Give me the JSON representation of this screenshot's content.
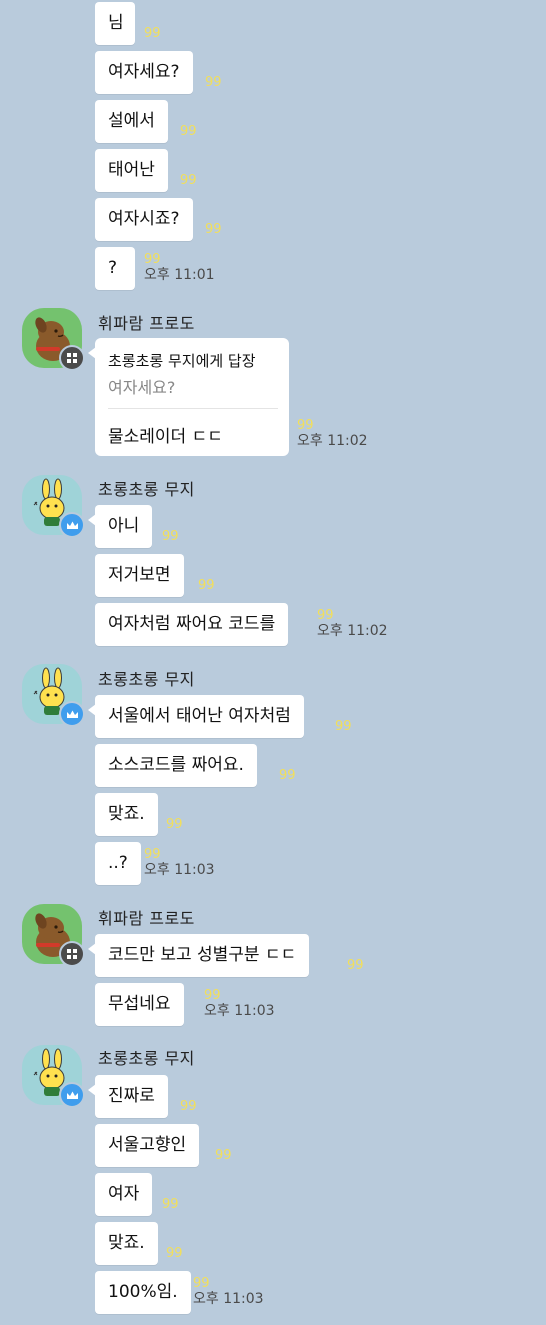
{
  "chat": {
    "groups": [
      {
        "messages": [
          {
            "text": "님",
            "unread": "99",
            "time": ""
          },
          {
            "text": "여자세요?",
            "unread": "99",
            "time": ""
          },
          {
            "text": "설에서",
            "unread": "99",
            "time": ""
          },
          {
            "text": "태어난",
            "unread": "99",
            "time": ""
          },
          {
            "text": "여자시죠?",
            "unread": "99",
            "time": ""
          },
          {
            "text": "?",
            "unread": "99",
            "time": "오후 11:01"
          }
        ]
      },
      {
        "sender": "휘파람 프로도",
        "avatar": "frodo-avatar",
        "badge": "manager-badge-icon",
        "reply": {
          "header": "초롱초롱 무지에게 답장",
          "quoted": "여자세요?",
          "text": "물소레이더 ㄷㄷ",
          "unread": "99",
          "time": "오후 11:02"
        }
      },
      {
        "sender": "초롱초롱 무지",
        "avatar": "muzi-avatar",
        "badge": "crown-icon",
        "messages": [
          {
            "text": "아니",
            "unread": "99",
            "time": ""
          },
          {
            "text": "저거보면",
            "unread": "99",
            "time": ""
          },
          {
            "text": "여자처럼 짜어요 코드를",
            "unread": "99",
            "time": "오후 11:02"
          }
        ]
      },
      {
        "sender": "초롱초롱 무지",
        "avatar": "muzi-avatar",
        "badge": "crown-icon",
        "messages": [
          {
            "text": "서울에서 태어난 여자처럼",
            "unread": "99",
            "time": ""
          },
          {
            "text": "소스코드를 짜어요.",
            "unread": "99",
            "time": ""
          },
          {
            "text": "맞죠.",
            "unread": "99",
            "time": ""
          },
          {
            "text": "..?",
            "unread": "99",
            "time": "오후 11:03"
          }
        ]
      },
      {
        "sender": "휘파람 프로도",
        "avatar": "frodo-avatar",
        "badge": "manager-badge-icon",
        "messages": [
          {
            "text": "코드만 보고 성별구분 ㄷㄷ",
            "unread": "99",
            "time": ""
          },
          {
            "text": "무섭네요",
            "unread": "99",
            "time": "오후 11:03"
          }
        ]
      },
      {
        "sender": "초롱초롱 무지",
        "avatar": "muzi-avatar",
        "badge": "crown-icon",
        "messages": [
          {
            "text": "진짜로",
            "unread": "99",
            "time": ""
          },
          {
            "text": "서울고향인",
            "unread": "99",
            "time": ""
          },
          {
            "text": "여자",
            "unread": "99",
            "time": ""
          },
          {
            "text": "맞죠.",
            "unread": "99",
            "time": ""
          },
          {
            "text": "100%임.",
            "unread": "99",
            "time": "오후 11:03"
          }
        ]
      }
    ]
  },
  "colors": {
    "background": "#b9cbdc",
    "bubble": "#ffffff",
    "unread": "#f2df5a",
    "host_badge": "#3f9ded"
  }
}
